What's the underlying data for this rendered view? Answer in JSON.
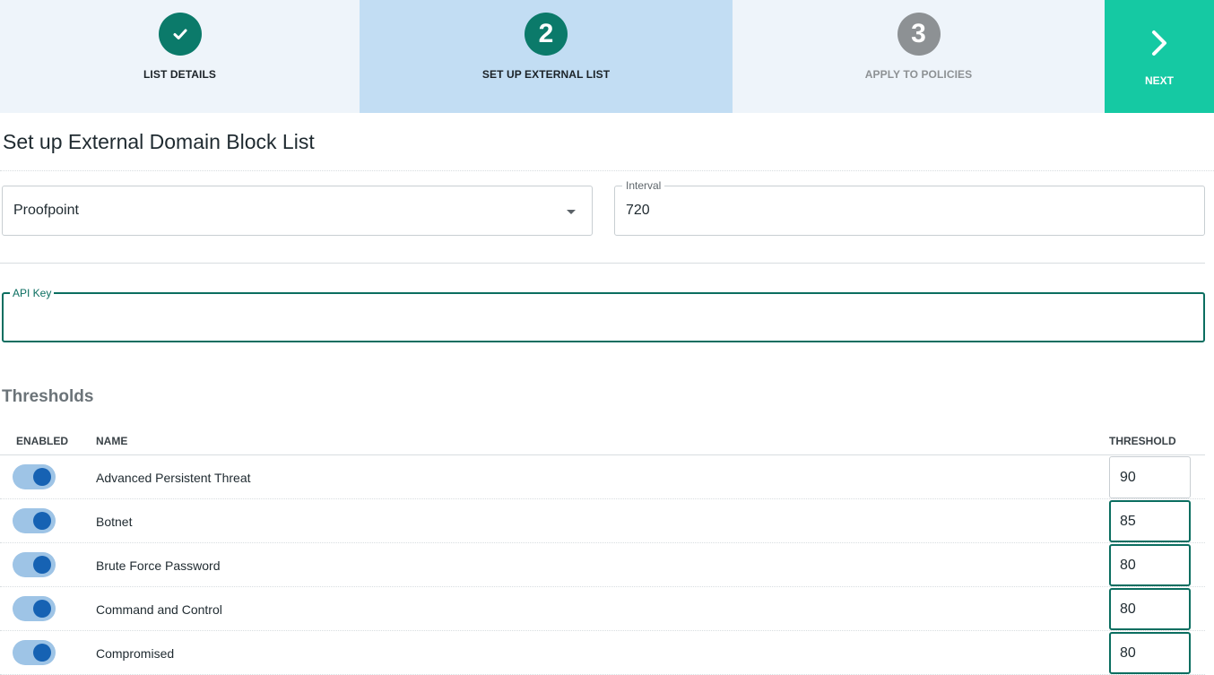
{
  "stepper": {
    "steps": [
      {
        "number": "✓",
        "label": "LIST DETAILS",
        "state": "done"
      },
      {
        "number": "2",
        "label": "SET UP EXTERNAL LIST",
        "state": "active"
      },
      {
        "number": "3",
        "label": "APPLY TO POLICIES",
        "state": "pending"
      }
    ],
    "next_label": "NEXT"
  },
  "page": {
    "title": "Set up External Domain Block List"
  },
  "form": {
    "provider_value": "Proofpoint",
    "interval_label": "Interval",
    "interval_value": "720",
    "api_key_label": "API Key",
    "api_key_value": ""
  },
  "thresholds": {
    "title": "Thresholds",
    "columns": {
      "enabled": "ENABLED",
      "name": "NAME",
      "threshold": "THRESHOLD"
    },
    "rows": [
      {
        "name": "Advanced Persistent Threat",
        "threshold": "90",
        "enabled": true
      },
      {
        "name": "Botnet",
        "threshold": "85",
        "enabled": true
      },
      {
        "name": "Brute Force Password",
        "threshold": "80",
        "enabled": true
      },
      {
        "name": "Command and Control",
        "threshold": "80",
        "enabled": true
      },
      {
        "name": "Compromised",
        "threshold": "80",
        "enabled": true
      }
    ]
  },
  "colors": {
    "accent_teal": "#0b7a6a",
    "next_button": "#15c9a3",
    "active_step_bg": "#c2ddf3",
    "toggle_on": "#1662b3"
  }
}
